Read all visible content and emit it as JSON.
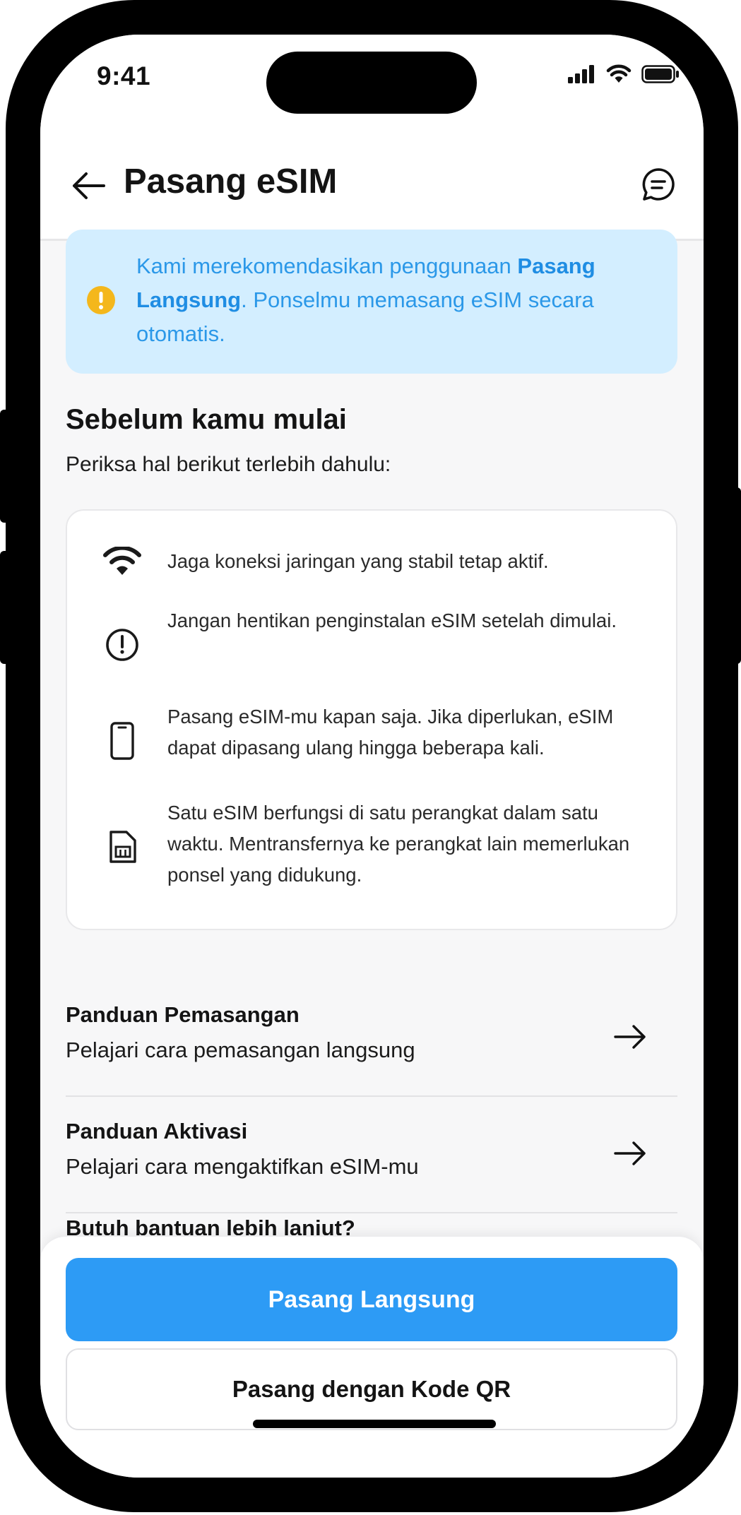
{
  "status_bar": {
    "time": "9:41",
    "icons": [
      "cellular-signal-icon",
      "wifi-icon",
      "battery-icon"
    ]
  },
  "header": {
    "title": "Pasang eSIM",
    "back_icon": "arrow-left-icon",
    "chat_icon": "chat-bubble-icon"
  },
  "banner": {
    "icon": "warning-circle-icon",
    "text_before": "Kami merekomendasikan penggunaan ",
    "highlight": "Pasang Langsung",
    "text_after": ". Ponselmu memasang eSIM secara otomatis."
  },
  "section": {
    "title": "Sebelum kamu mulai",
    "subtitle": "Periksa hal berikut terlebih dahulu:"
  },
  "checklist": [
    {
      "icon": "wifi-icon",
      "text": "Jaga koneksi jaringan yang stabil tetap aktif."
    },
    {
      "icon": "alert-circle-icon",
      "text": "Jangan hentikan penginstalan eSIM setelah dimulai."
    },
    {
      "icon": "phone-icon",
      "text": "Pasang eSIM-mu kapan saja. Jika diperlukan, eSIM dapat dipasang ulang hingga beberapa kali."
    },
    {
      "icon": "sim-card-icon",
      "text": "Satu eSIM berfungsi di satu perangkat dalam satu waktu. Mentransfernya ke perangkat lain memerlukan ponsel yang didukung."
    }
  ],
  "guides": [
    {
      "title": "Panduan Pemasangan",
      "subtitle": "Pelajari cara pemasangan langsung"
    },
    {
      "title": "Panduan Aktivasi",
      "subtitle": "Pelajari cara mengaktifkan eSIM-mu"
    }
  ],
  "help": {
    "title": "Butuh bantuan lebih lanjut?"
  },
  "actions": {
    "primary": "Pasang Langsung",
    "secondary": "Pasang dengan Kode QR"
  },
  "colors": {
    "primary": "#2d9bf5",
    "banner_bg": "#d3eeff",
    "banner_text": "#2b98e8",
    "warning": "#f4b71c"
  }
}
